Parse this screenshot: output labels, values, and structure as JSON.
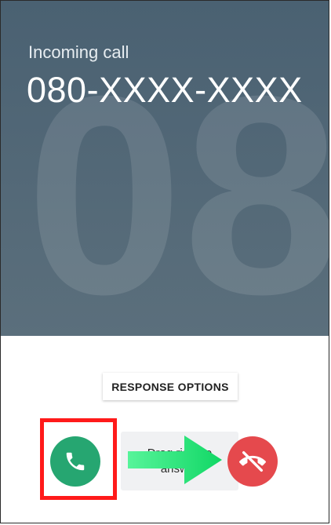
{
  "call": {
    "status_label": "Incoming call",
    "number": "080-XXXX-XXXX",
    "monogram": "08"
  },
  "controls": {
    "response_options_label": "RESPONSE OPTIONS",
    "drag_hint": "Drag right to answer",
    "answer_icon": "phone-icon",
    "decline_icon": "phone-hangup-icon"
  },
  "colors": {
    "panel": "#4a6172",
    "answer": "#26a671",
    "decline": "#e5494d",
    "highlight": "#ff1a1a",
    "arrow": "#22e57a"
  }
}
